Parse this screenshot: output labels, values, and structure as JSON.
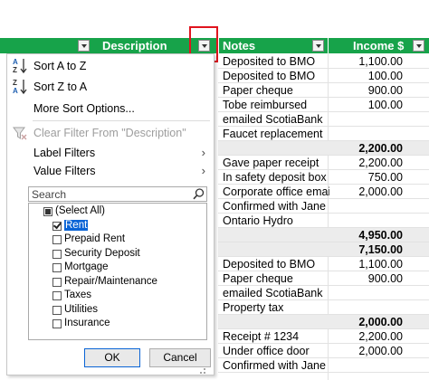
{
  "header": {
    "description": "Description",
    "notes": "Notes",
    "income": "Income $"
  },
  "menu": {
    "sort_az": "Sort A to Z",
    "sort_za": "Sort Z to A",
    "more_sort": "More Sort Options...",
    "clear_filter": "Clear Filter From \"Description\"",
    "label_filters": "Label Filters",
    "value_filters": "Value Filters",
    "search_placeholder": "Search",
    "items": [
      {
        "label": "(Select All)",
        "state": "partial"
      },
      {
        "label": "Rent",
        "state": "checked",
        "selected": true
      },
      {
        "label": "Prepaid Rent",
        "state": "unchecked"
      },
      {
        "label": "Security Deposit",
        "state": "unchecked"
      },
      {
        "label": "Mortgage",
        "state": "unchecked"
      },
      {
        "label": "Repair/Maintenance",
        "state": "unchecked"
      },
      {
        "label": "Taxes",
        "state": "unchecked"
      },
      {
        "label": "Utilities",
        "state": "unchecked"
      },
      {
        "label": "Insurance",
        "state": "unchecked"
      }
    ],
    "ok": "OK",
    "cancel": "Cancel"
  },
  "rows": [
    {
      "note": "Deposited to BMO",
      "value": "1,100.00"
    },
    {
      "note": "Deposited to BMO",
      "value": "100.00"
    },
    {
      "note": "Paper cheque",
      "value": "900.00"
    },
    {
      "note": "Tobe reimbursed",
      "value": "100.00"
    },
    {
      "note": "emailed ScotiaBank",
      "value": ""
    },
    {
      "note": "Faucet replacement",
      "value": ""
    },
    {
      "note": "",
      "value": "2,200.00",
      "subtotal": true
    },
    {
      "note": "Gave paper receipt",
      "value": "2,200.00"
    },
    {
      "note": "In safety deposit box",
      "value": "750.00"
    },
    {
      "note": "Corporate office emails",
      "value": "2,000.00"
    },
    {
      "note": "Confirmed with Jane",
      "value": ""
    },
    {
      "note": "Ontario Hydro",
      "value": ""
    },
    {
      "note": "",
      "value": "4,950.00",
      "subtotal": true
    },
    {
      "note": "",
      "value": "7,150.00",
      "subtotal": true
    },
    {
      "note": "Deposited to BMO",
      "value": "1,100.00"
    },
    {
      "note": "Paper cheque",
      "value": "900.00"
    },
    {
      "note": "emailed ScotiaBank",
      "value": ""
    },
    {
      "note": "Property tax",
      "value": ""
    },
    {
      "note": "",
      "value": "2,000.00",
      "subtotal": true
    },
    {
      "note": "Receipt # 1234",
      "value": "2,200.00"
    },
    {
      "note": "Under office door",
      "value": "2,000.00"
    },
    {
      "note": "Confirmed with Jane",
      "value": ""
    }
  ],
  "colors": {
    "header_green": "#17a34a",
    "highlight_red": "#e0141e",
    "selection_blue": "#0a64d6"
  }
}
